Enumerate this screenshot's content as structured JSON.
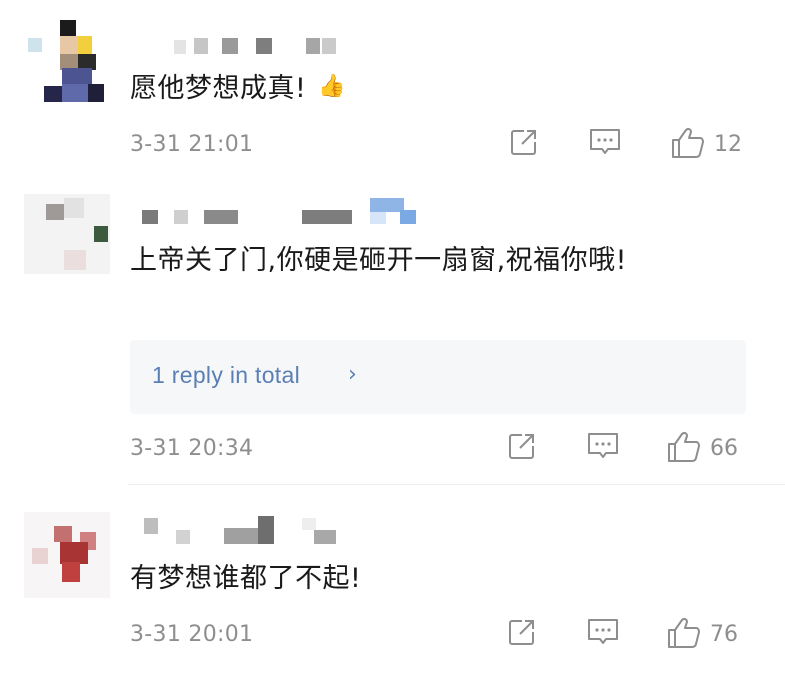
{
  "comments": [
    {
      "text": "愿他梦想成真!",
      "emoji": "👍",
      "timestamp": "3-31 21:01",
      "likes": "12",
      "icons": [
        "share-icon",
        "comment-icon",
        "like-icon"
      ]
    },
    {
      "text": "上帝关了门,你硬是砸开一扇窗,祝福你哦!",
      "timestamp": "3-31 20:34",
      "likes": "66",
      "replies_label": "1 reply in total",
      "replies_chevron": "›",
      "icons": [
        "share-icon",
        "comment-icon",
        "like-icon"
      ]
    },
    {
      "text": "有梦想谁都了不起!",
      "timestamp": "3-31 20:01",
      "likes": "76",
      "icons": [
        "share-icon",
        "comment-icon",
        "like-icon"
      ]
    }
  ],
  "colors": {
    "text": "#1a1a1a",
    "meta": "#8e8e8e",
    "link": "#5a7fb5",
    "reply_bg": "#f6f7f9",
    "divider": "#ececec"
  }
}
